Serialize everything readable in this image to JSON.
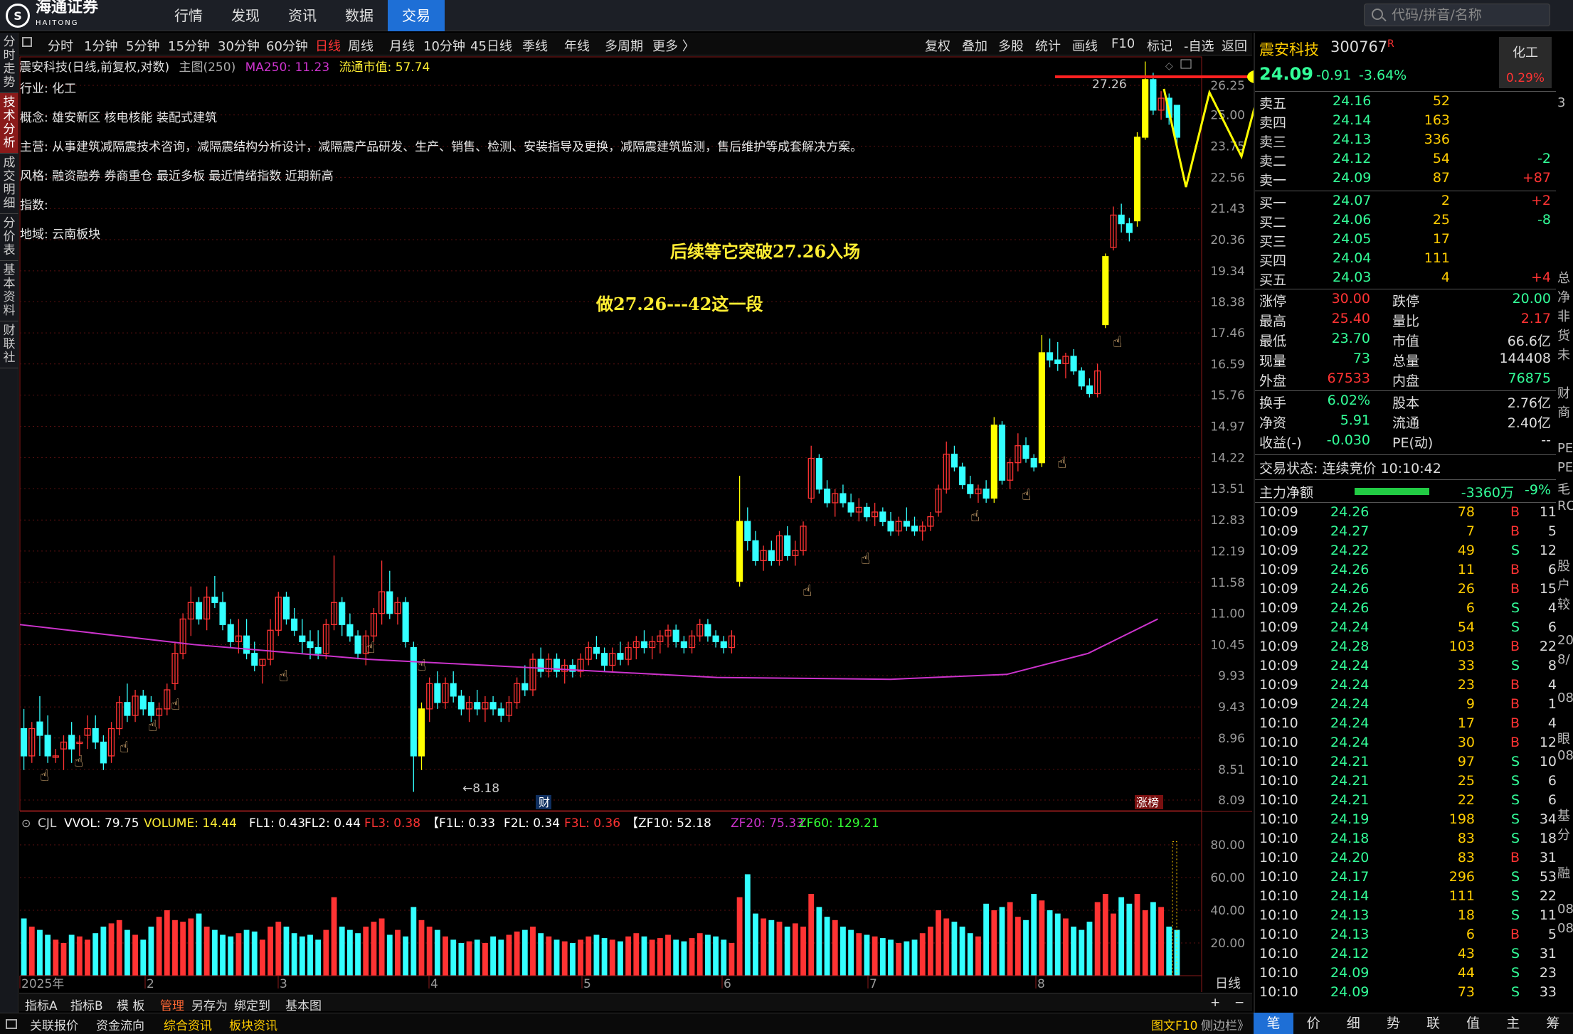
{
  "topbar": {
    "logo_text": "海通证券",
    "logo_sub": "HAITONG",
    "nav": [
      "行情",
      "发现",
      "资讯",
      "数据",
      "交易"
    ],
    "search_placeholder": "代码/拼音/名称"
  },
  "left_tabs": [
    "分时走势",
    "技术分析",
    "成交明细",
    "分价表",
    "基本资料",
    "财联社"
  ],
  "period_bar": {
    "items": [
      "分时",
      "1分钟",
      "5分钟",
      "15分钟",
      "30分钟",
      "60分钟",
      "日线",
      "周线",
      "月线",
      "10分钟",
      "45日线",
      "季线",
      "年线",
      "多周期",
      "更多 〉"
    ],
    "active": "日线",
    "right_items": [
      "复权",
      "叠加",
      "多股",
      "统计",
      "画线",
      "F10",
      "标记",
      "-自选",
      "返回"
    ]
  },
  "chart_title": {
    "name": "震安科技(日线,前复权,对数)",
    "main": "主图(250)",
    "ma": "MA250: 11.23",
    "mcap": "流通市值: 57.74"
  },
  "info": {
    "industry_label": "行业:",
    "industry": "化工",
    "concept_label": "概念:",
    "concept": "雄安新区 核电核能 装配式建筑",
    "business_label": "主营:",
    "business": "从事建筑减隔震技术咨询，减隔震结构分析设计，减隔震产品研发、生产、销售、检测、安装指导及更换，减隔震建筑监测，售后维护等成套解决方案。",
    "style_label": "风格:",
    "style": "融资融券 券商重仓 最近多板 最近情绪指数 近期新高",
    "index_label": "指数:",
    "index": "",
    "region_label": "地域:",
    "region": "云南板块"
  },
  "annotations": {
    "line1": "后续等它突破27.26入场",
    "line2": "做27.26---42这一段",
    "high_label": "27.26",
    "low_label": "←8.18",
    "fin_tag": "财",
    "zt_tag": "涨榜"
  },
  "price_axis": [
    "26.25",
    "25.00",
    "23.75",
    "22.56",
    "21.43",
    "20.36",
    "19.34",
    "18.38",
    "17.46",
    "16.59",
    "15.76",
    "14.97",
    "14.22",
    "13.51",
    "12.83",
    "12.19",
    "11.58",
    "11.00",
    "10.45",
    "9.93",
    "9.43",
    "8.96",
    "8.51",
    "8.09"
  ],
  "indicator_line": {
    "cjl": "CJL",
    "vvol": "VVOL: 79.75",
    "volume": "VOLUME: 14.44",
    "fl1": "FL1: 0.43",
    "fl2": "FL2: 0.44",
    "fl3": "FL3: 0.38",
    "f1l": "【F1L: 0.33",
    "f2l": "F2L: 0.34",
    "f3l": "F3L: 0.36",
    "zf10": "【ZF10: 52.18",
    "zf20": "ZF20: 75.33",
    "zf60": "ZF60: 129.21"
  },
  "volume_axis": [
    "80.00",
    "60.00",
    "40.00",
    "20.00"
  ],
  "time_axis": [
    "2025年",
    "2",
    "3",
    "4",
    "5",
    "6",
    "7",
    "8"
  ],
  "period_label": "日线",
  "stock": {
    "name": "震安科技",
    "code": "300767",
    "flag": "R",
    "price": "24.09",
    "change": "-0.91",
    "pct": "-3.64%",
    "sector": "化工",
    "sector_pct": "0.29%"
  },
  "asks": [
    {
      "label": "卖五",
      "price": "24.16",
      "vol": "52",
      "chg": ""
    },
    {
      "label": "卖四",
      "price": "24.14",
      "vol": "163",
      "chg": ""
    },
    {
      "label": "卖三",
      "price": "24.13",
      "vol": "336",
      "chg": ""
    },
    {
      "label": "卖二",
      "price": "24.12",
      "vol": "54",
      "chg": "-2"
    },
    {
      "label": "卖一",
      "price": "24.09",
      "vol": "87",
      "chg": "+87"
    }
  ],
  "bids": [
    {
      "label": "买一",
      "price": "24.07",
      "vol": "2",
      "chg": "+2"
    },
    {
      "label": "买二",
      "price": "24.06",
      "vol": "25",
      "chg": "-8"
    },
    {
      "label": "买三",
      "price": "24.05",
      "vol": "17",
      "chg": ""
    },
    {
      "label": "买四",
      "price": "24.04",
      "vol": "111",
      "chg": ""
    },
    {
      "label": "买五",
      "price": "24.03",
      "vol": "4",
      "chg": "+4"
    }
  ],
  "stats1": [
    [
      "涨停",
      "30.00",
      "跌停",
      "20.00"
    ],
    [
      "最高",
      "25.40",
      "量比",
      "2.17"
    ],
    [
      "最低",
      "23.70",
      "市值",
      "66.6亿"
    ],
    [
      "现量",
      "73",
      "总量",
      "144408"
    ],
    [
      "外盘",
      "67533",
      "内盘",
      "76875"
    ]
  ],
  "stats2": [
    [
      "换手",
      "6.02%",
      "股本",
      "2.76亿"
    ],
    [
      "净资",
      "5.91",
      "流通",
      "2.40亿"
    ],
    [
      "收益(-)",
      "-0.030",
      "PE(动)",
      "--"
    ]
  ],
  "trade_status": "交易状态: 连续竞价 10:10:42",
  "main_flow": {
    "label": "主力净额",
    "value": "-3360万",
    "pct": "-9%"
  },
  "ticks": [
    [
      "10:09",
      "24.26",
      "78",
      "B",
      "11"
    ],
    [
      "10:09",
      "24.27",
      "7",
      "B",
      "5"
    ],
    [
      "10:09",
      "24.22",
      "49",
      "S",
      "12"
    ],
    [
      "10:09",
      "24.26",
      "11",
      "B",
      "6"
    ],
    [
      "10:09",
      "24.26",
      "26",
      "B",
      "15"
    ],
    [
      "10:09",
      "24.26",
      "6",
      "S",
      "4"
    ],
    [
      "10:09",
      "24.24",
      "54",
      "S",
      "6"
    ],
    [
      "10:09",
      "24.28",
      "103",
      "B",
      "22"
    ],
    [
      "10:09",
      "24.24",
      "33",
      "S",
      "8"
    ],
    [
      "10:09",
      "24.24",
      "23",
      "B",
      "4"
    ],
    [
      "10:09",
      "24.24",
      "9",
      "B",
      "1"
    ],
    [
      "10:10",
      "24.24",
      "17",
      "B",
      "4"
    ],
    [
      "10:10",
      "24.24",
      "30",
      "B",
      "12"
    ],
    [
      "10:10",
      "24.21",
      "97",
      "S",
      "10"
    ],
    [
      "10:10",
      "24.21",
      "25",
      "S",
      "6"
    ],
    [
      "10:10",
      "24.21",
      "22",
      "S",
      "6"
    ],
    [
      "10:10",
      "24.19",
      "198",
      "S",
      "34"
    ],
    [
      "10:10",
      "24.18",
      "83",
      "S",
      "18"
    ],
    [
      "10:10",
      "24.20",
      "83",
      "B",
      "31"
    ],
    [
      "10:10",
      "24.17",
      "296",
      "S",
      "53"
    ],
    [
      "10:10",
      "24.14",
      "111",
      "S",
      "22"
    ],
    [
      "10:10",
      "24.13",
      "18",
      "S",
      "11"
    ],
    [
      "10:10",
      "24.13",
      "6",
      "B",
      "5"
    ],
    [
      "10:10",
      "24.12",
      "43",
      "S",
      "31"
    ],
    [
      "10:10",
      "24.09",
      "44",
      "S",
      "23"
    ],
    [
      "10:10",
      "24.09",
      "73",
      "S",
      "33"
    ]
  ],
  "bottom1": [
    "指标A",
    "指标B",
    "模 板",
    "管理",
    "另存为",
    "绑定到",
    "基本图"
  ],
  "bottom2": [
    "关联报价",
    "资金流向",
    "综合资讯",
    "板块资讯"
  ],
  "bottom2_right": [
    "图文F10",
    "侧边栏》"
  ],
  "right_tabs": [
    "笔",
    "价",
    "细",
    "势",
    "联",
    "值",
    "主",
    "筹"
  ],
  "far_right": [
    "3",
    "",
    "",
    "",
    "",
    "",
    "",
    "",
    "",
    "总",
    "净",
    "非",
    "货",
    "未",
    "",
    "财",
    "商",
    "",
    "PE",
    "PE",
    "毛",
    "RO",
    "",
    "",
    "股",
    "户",
    "较",
    "",
    "20",
    "8/",
    "",
    "08",
    "",
    "眼",
    "08",
    "",
    "",
    "基",
    "分",
    "",
    "融",
    "",
    "08",
    "08"
  ],
  "colors": {
    "up": "#ff3333",
    "down": "#33ffff",
    "ma": "#cc33cc",
    "hl": "#ffff00"
  },
  "chart_data": {
    "type": "candlestick",
    "title": "震安科技(日线,前复权,对数)",
    "scale": "log",
    "ylim": [
      8.09,
      26.25
    ],
    "y_ticks": [
      26.25,
      25.0,
      23.75,
      22.56,
      21.43,
      20.36,
      19.34,
      18.38,
      17.46,
      16.59,
      15.76,
      14.97,
      14.22,
      13.51,
      12.83,
      12.19,
      11.58,
      11.0,
      10.45,
      9.93,
      9.43,
      8.96,
      8.51,
      8.09
    ],
    "x_labels": [
      "2025年",
      "2",
      "3",
      "4",
      "5",
      "6",
      "7",
      "8"
    ],
    "ohlc": [
      [
        9.1,
        9.4,
        8.5,
        8.7
      ],
      [
        8.7,
        9.2,
        8.6,
        9.1
      ],
      [
        9.2,
        9.6,
        8.7,
        9.0
      ],
      [
        9.0,
        9.3,
        8.6,
        8.7
      ],
      [
        8.7,
        8.8,
        8.6,
        8.7
      ],
      [
        8.8,
        9.0,
        8.5,
        8.9
      ],
      [
        9.0,
        9.2,
        8.6,
        8.8
      ],
      [
        8.9,
        9.0,
        8.7,
        8.9
      ],
      [
        9.0,
        9.3,
        8.8,
        9.1
      ],
      [
        9.1,
        9.3,
        8.8,
        8.9
      ],
      [
        8.9,
        9.0,
        8.5,
        8.6
      ],
      [
        8.7,
        9.2,
        8.6,
        9.1
      ],
      [
        9.1,
        9.6,
        9.0,
        9.5
      ],
      [
        9.5,
        9.8,
        9.2,
        9.3
      ],
      [
        9.3,
        9.7,
        9.2,
        9.6
      ],
      [
        9.6,
        9.7,
        9.3,
        9.4
      ],
      [
        9.5,
        9.6,
        9.2,
        9.3
      ],
      [
        9.3,
        9.5,
        9.1,
        9.4
      ],
      [
        9.4,
        9.8,
        9.3,
        9.7
      ],
      [
        9.8,
        10.5,
        9.7,
        10.3
      ],
      [
        10.3,
        11.0,
        10.2,
        10.9
      ],
      [
        10.9,
        11.5,
        10.6,
        11.2
      ],
      [
        11.2,
        11.3,
        10.8,
        10.9
      ],
      [
        10.9,
        11.5,
        10.7,
        11.3
      ],
      [
        11.3,
        11.7,
        11.1,
        11.2
      ],
      [
        11.2,
        11.4,
        10.7,
        10.8
      ],
      [
        10.8,
        10.9,
        10.4,
        10.5
      ],
      [
        10.5,
        10.9,
        10.3,
        10.6
      ],
      [
        10.6,
        10.9,
        10.2,
        10.3
      ],
      [
        10.3,
        10.5,
        10.0,
        10.1
      ],
      [
        10.1,
        10.2,
        9.8,
        10.2
      ],
      [
        10.2,
        10.9,
        10.1,
        10.7
      ],
      [
        10.7,
        11.4,
        10.6,
        11.3
      ],
      [
        11.3,
        11.4,
        10.8,
        10.9
      ],
      [
        10.9,
        11.1,
        10.6,
        10.7
      ],
      [
        10.6,
        10.9,
        10.3,
        10.5
      ],
      [
        10.5,
        10.7,
        10.2,
        10.4
      ],
      [
        10.4,
        10.7,
        10.2,
        10.3
      ],
      [
        10.3,
        10.9,
        10.2,
        10.8
      ],
      [
        10.8,
        12.1,
        10.7,
        11.2
      ],
      [
        11.2,
        11.3,
        10.6,
        10.8
      ],
      [
        10.8,
        11.0,
        10.5,
        10.6
      ],
      [
        10.6,
        10.7,
        10.2,
        10.3
      ],
      [
        10.3,
        10.7,
        10.1,
        10.6
      ],
      [
        10.6,
        11.1,
        10.5,
        11.0
      ],
      [
        11.0,
        12.0,
        10.8,
        11.4
      ],
      [
        11.4,
        11.8,
        10.9,
        11.0
      ],
      [
        11.0,
        11.3,
        10.8,
        11.2
      ],
      [
        11.2,
        11.3,
        10.4,
        10.5
      ],
      [
        10.4,
        10.5,
        8.2,
        8.7
      ],
      [
        8.7,
        9.5,
        8.5,
        9.4
      ],
      [
        9.4,
        9.9,
        9.2,
        9.8
      ],
      [
        9.8,
        10.0,
        9.4,
        9.5
      ],
      [
        9.5,
        9.9,
        9.4,
        9.8
      ],
      [
        9.8,
        10.0,
        9.5,
        9.6
      ],
      [
        9.6,
        9.7,
        9.3,
        9.4
      ],
      [
        9.4,
        9.6,
        9.2,
        9.5
      ],
      [
        9.5,
        9.7,
        9.3,
        9.4
      ],
      [
        9.4,
        9.6,
        9.2,
        9.5
      ],
      [
        9.5,
        9.6,
        9.3,
        9.4
      ],
      [
        9.4,
        9.5,
        9.2,
        9.3
      ],
      [
        9.3,
        9.6,
        9.2,
        9.5
      ],
      [
        9.5,
        9.9,
        9.4,
        9.8
      ],
      [
        9.8,
        10.1,
        9.6,
        9.7
      ],
      [
        9.7,
        10.3,
        9.6,
        10.2
      ],
      [
        10.2,
        10.4,
        9.9,
        10.0
      ],
      [
        10.0,
        10.3,
        9.9,
        10.2
      ],
      [
        10.2,
        10.3,
        9.9,
        10.0
      ],
      [
        10.0,
        10.2,
        9.8,
        10.1
      ],
      [
        10.1,
        10.2,
        9.9,
        10.0
      ],
      [
        10.0,
        10.3,
        9.9,
        10.2
      ],
      [
        10.2,
        10.5,
        10.1,
        10.4
      ],
      [
        10.4,
        10.6,
        10.2,
        10.3
      ],
      [
        10.3,
        10.4,
        10.0,
        10.1
      ],
      [
        10.1,
        10.4,
        10.0,
        10.3
      ],
      [
        10.3,
        10.5,
        10.1,
        10.2
      ],
      [
        10.2,
        10.5,
        10.1,
        10.4
      ],
      [
        10.4,
        10.6,
        10.2,
        10.5
      ],
      [
        10.5,
        10.7,
        10.3,
        10.4
      ],
      [
        10.4,
        10.6,
        10.2,
        10.5
      ],
      [
        10.5,
        10.7,
        10.3,
        10.6
      ],
      [
        10.6,
        10.8,
        10.4,
        10.7
      ],
      [
        10.7,
        10.8,
        10.4,
        10.5
      ],
      [
        10.5,
        10.6,
        10.3,
        10.4
      ],
      [
        10.4,
        10.7,
        10.3,
        10.6
      ],
      [
        10.6,
        10.9,
        10.5,
        10.8
      ],
      [
        10.8,
        10.9,
        10.5,
        10.6
      ],
      [
        10.6,
        10.7,
        10.4,
        10.5
      ],
      [
        10.5,
        10.6,
        10.3,
        10.4
      ],
      [
        10.4,
        10.7,
        10.3,
        10.6
      ],
      [
        11.6,
        13.8,
        11.5,
        12.8
      ],
      [
        12.8,
        13.1,
        12.2,
        12.4
      ],
      [
        12.4,
        12.6,
        11.9,
        12.0
      ],
      [
        12.0,
        12.3,
        11.8,
        12.2
      ],
      [
        12.2,
        12.4,
        11.9,
        12.0
      ],
      [
        12.0,
        12.6,
        11.9,
        12.5
      ],
      [
        12.5,
        12.7,
        12.0,
        12.1
      ],
      [
        12.1,
        12.4,
        11.9,
        12.2
      ],
      [
        12.2,
        12.8,
        12.1,
        12.7
      ],
      [
        13.3,
        14.5,
        13.2,
        14.2
      ],
      [
        14.2,
        14.3,
        13.4,
        13.5
      ],
      [
        13.5,
        13.7,
        13.1,
        13.2
      ],
      [
        13.2,
        13.5,
        12.9,
        13.4
      ],
      [
        13.4,
        13.6,
        13.1,
        13.2
      ],
      [
        13.2,
        13.4,
        12.9,
        13.0
      ],
      [
        13.0,
        13.3,
        12.8,
        13.1
      ],
      [
        13.1,
        13.2,
        12.8,
        12.9
      ],
      [
        12.9,
        13.2,
        12.7,
        13.0
      ],
      [
        13.0,
        13.1,
        12.7,
        12.8
      ],
      [
        12.8,
        13.0,
        12.5,
        12.6
      ],
      [
        12.6,
        12.9,
        12.5,
        12.8
      ],
      [
        12.8,
        13.1,
        12.6,
        12.7
      ],
      [
        12.7,
        12.9,
        12.5,
        12.6
      ],
      [
        12.6,
        12.8,
        12.4,
        12.7
      ],
      [
        12.7,
        13.0,
        12.6,
        12.9
      ],
      [
        13.0,
        13.6,
        12.9,
        13.5
      ],
      [
        13.5,
        14.6,
        13.4,
        14.3
      ],
      [
        14.3,
        14.5,
        13.9,
        14.0
      ],
      [
        14.0,
        14.1,
        13.5,
        13.6
      ],
      [
        13.6,
        13.8,
        13.3,
        13.4
      ],
      [
        13.4,
        13.6,
        13.2,
        13.5
      ],
      [
        13.5,
        13.7,
        13.2,
        13.3
      ],
      [
        13.3,
        15.2,
        13.2,
        15.0
      ],
      [
        15.0,
        15.1,
        13.6,
        13.7
      ],
      [
        13.7,
        14.2,
        13.5,
        14.1
      ],
      [
        14.1,
        14.8,
        13.9,
        14.5
      ],
      [
        14.5,
        14.7,
        14.1,
        14.2
      ],
      [
        14.2,
        14.3,
        13.9,
        14.0
      ],
      [
        14.1,
        17.4,
        14.0,
        16.9
      ],
      [
        16.9,
        17.3,
        16.5,
        16.7
      ],
      [
        16.7,
        17.2,
        16.4,
        16.6
      ],
      [
        16.6,
        16.9,
        16.2,
        16.8
      ],
      [
        16.8,
        17.0,
        16.3,
        16.4
      ],
      [
        16.4,
        16.5,
        15.9,
        16.0
      ],
      [
        16.0,
        16.2,
        15.7,
        15.8
      ],
      [
        15.8,
        16.6,
        15.7,
        16.4
      ],
      [
        17.7,
        19.9,
        17.6,
        19.8
      ],
      [
        20.1,
        21.5,
        20.0,
        21.2
      ],
      [
        21.2,
        21.6,
        20.6,
        20.9
      ],
      [
        20.9,
        21.1,
        20.3,
        20.6
      ],
      [
        21.0,
        24.3,
        20.8,
        24.1
      ],
      [
        24.1,
        27.3,
        24.0,
        26.5
      ],
      [
        26.5,
        26.8,
        25.0,
        25.2
      ],
      [
        25.2,
        26.0,
        24.8,
        25.7
      ],
      [
        25.7,
        25.9,
        24.6,
        24.9
      ],
      [
        25.4,
        25.4,
        23.7,
        24.1
      ]
    ],
    "ma250": [
      [
        0,
        10.8
      ],
      [
        0.15,
        10.45
      ],
      [
        0.3,
        10.2
      ],
      [
        0.45,
        10.05
      ],
      [
        0.6,
        9.9
      ],
      [
        0.75,
        9.87
      ],
      [
        0.85,
        9.95
      ],
      [
        0.92,
        10.3
      ],
      [
        0.98,
        10.9
      ]
    ],
    "volume": [
      35,
      30,
      28,
      25,
      22,
      20,
      25,
      24,
      22,
      26,
      30,
      32,
      34,
      28,
      25,
      22,
      30,
      36,
      40,
      34,
      33,
      35,
      38,
      30,
      28,
      25,
      24,
      26,
      28,
      27,
      22,
      30,
      33,
      30,
      26,
      24,
      25,
      22,
      28,
      48,
      30,
      28,
      26,
      30,
      33,
      35,
      25,
      28,
      24,
      42,
      34,
      30,
      28,
      24,
      22,
      20,
      21,
      22,
      20,
      24,
      22,
      25,
      27,
      28,
      30,
      26,
      24,
      22,
      21,
      20,
      22,
      24,
      25,
      23,
      22,
      21,
      24,
      26,
      24,
      22,
      23,
      25,
      22,
      21,
      23,
      26,
      25,
      24,
      22,
      20,
      48,
      62,
      38,
      35,
      34,
      33,
      30,
      32,
      30,
      50,
      42,
      36,
      34,
      30,
      28,
      26,
      25,
      24,
      23,
      22,
      20,
      21,
      22,
      26,
      30,
      40,
      35,
      33,
      30,
      26,
      24,
      44,
      40,
      42,
      45,
      36,
      34,
      50,
      46,
      40,
      38,
      35,
      30,
      28,
      33,
      45,
      50,
      38,
      48,
      44,
      50,
      40,
      45,
      42,
      30,
      28
    ],
    "vol_ylim": [
      0,
      90
    ]
  }
}
